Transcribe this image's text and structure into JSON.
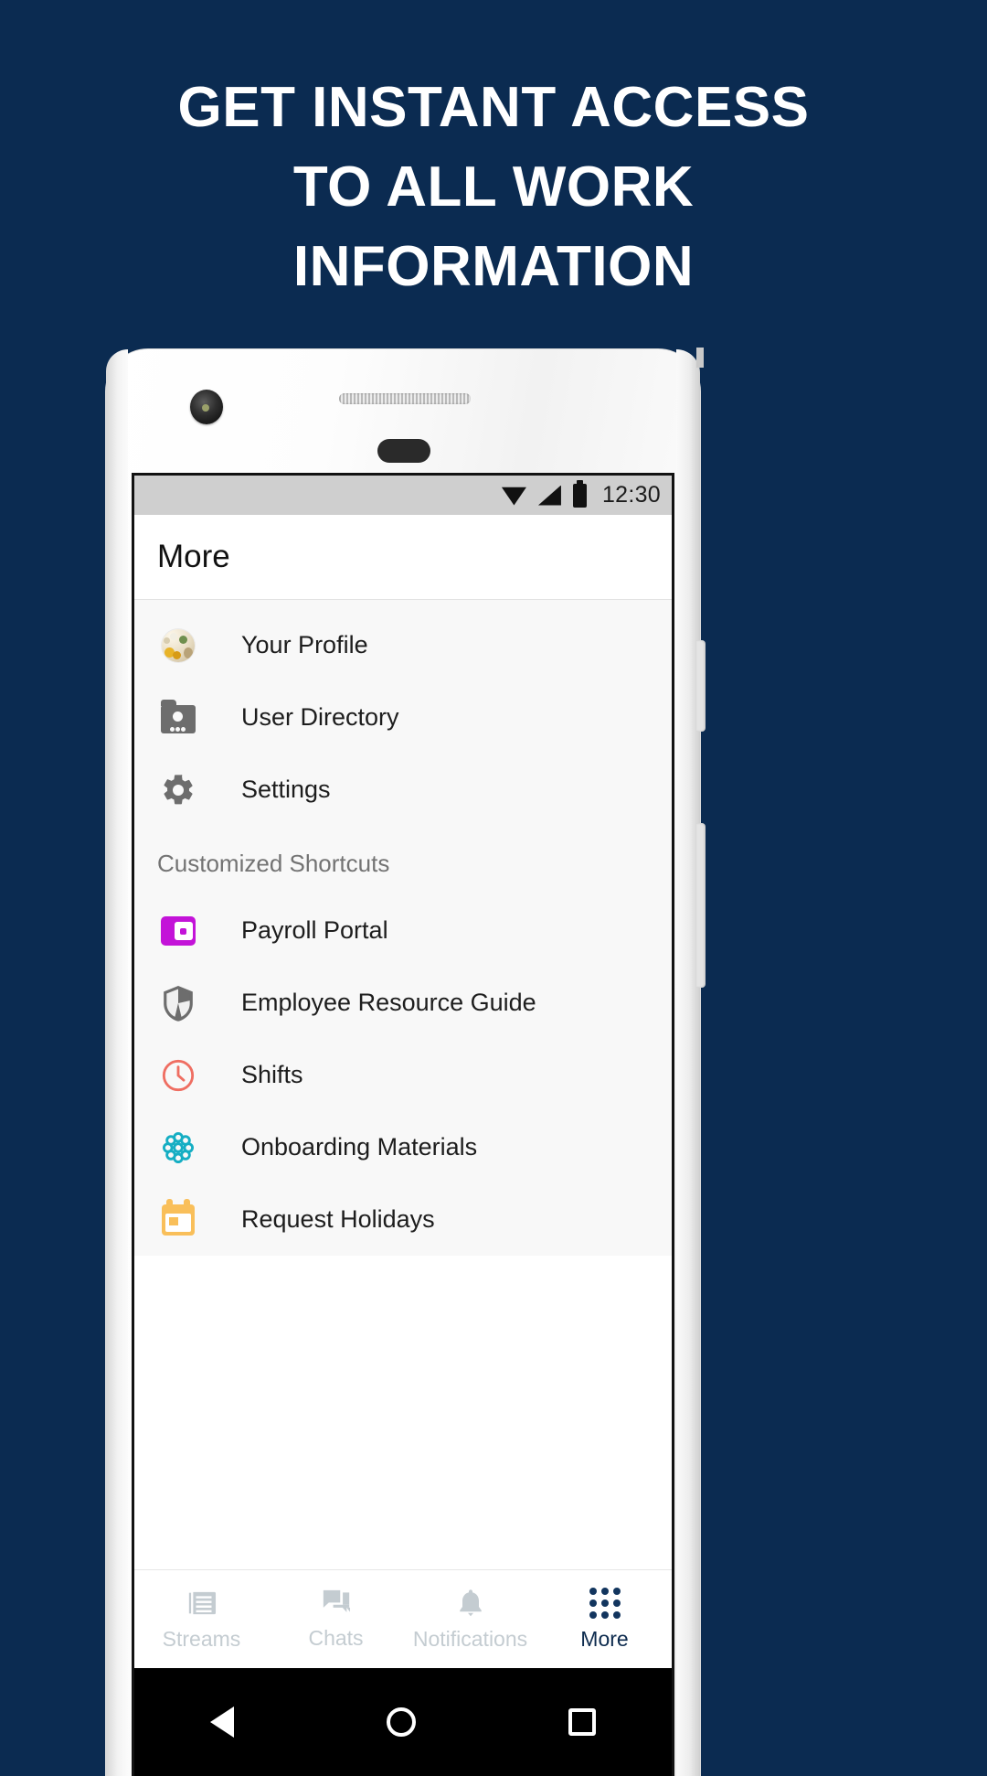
{
  "promo": {
    "headline_lines": [
      "GET INSTANT ACCESS",
      "TO ALL WORK",
      "INFORMATION"
    ],
    "background_color": "#0b2b51"
  },
  "status_bar": {
    "time": "12:30",
    "icons": [
      "wifi-icon",
      "signal-icon",
      "battery-icon"
    ]
  },
  "app_bar": {
    "title": "More"
  },
  "menu": {
    "primary_items": [
      {
        "label": "Your Profile",
        "icon": "avatar-photo-icon"
      },
      {
        "label": "User Directory",
        "icon": "folder-person-icon"
      },
      {
        "label": "Settings",
        "icon": "gear-icon"
      }
    ],
    "section_title": "Customized Shortcuts",
    "shortcut_items": [
      {
        "label": "Payroll Portal",
        "icon": "wallet-icon",
        "color": "#c313d8"
      },
      {
        "label": "Employee Resource Guide",
        "icon": "shield-icon",
        "color": "#6d6d6d"
      },
      {
        "label": "Shifts",
        "icon": "clock-icon",
        "color": "#ef6e62"
      },
      {
        "label": "Onboarding Materials",
        "icon": "rosette-icon",
        "color": "#15aec3"
      },
      {
        "label": "Request Holidays",
        "icon": "calendar-icon",
        "color": "#f9bf5a"
      }
    ]
  },
  "tab_bar": {
    "active_color": "#0d2b4e",
    "inactive_color": "#c4ccd1",
    "tabs": [
      {
        "label": "Streams",
        "icon": "streams-icon",
        "active": false
      },
      {
        "label": "Chats",
        "icon": "chats-icon",
        "active": false
      },
      {
        "label": "Notifications",
        "icon": "bell-icon",
        "active": false
      },
      {
        "label": "More",
        "icon": "grid-dots-icon",
        "active": true
      }
    ]
  },
  "android_nav": {
    "buttons": [
      "back-icon",
      "home-icon",
      "recents-icon"
    ]
  }
}
